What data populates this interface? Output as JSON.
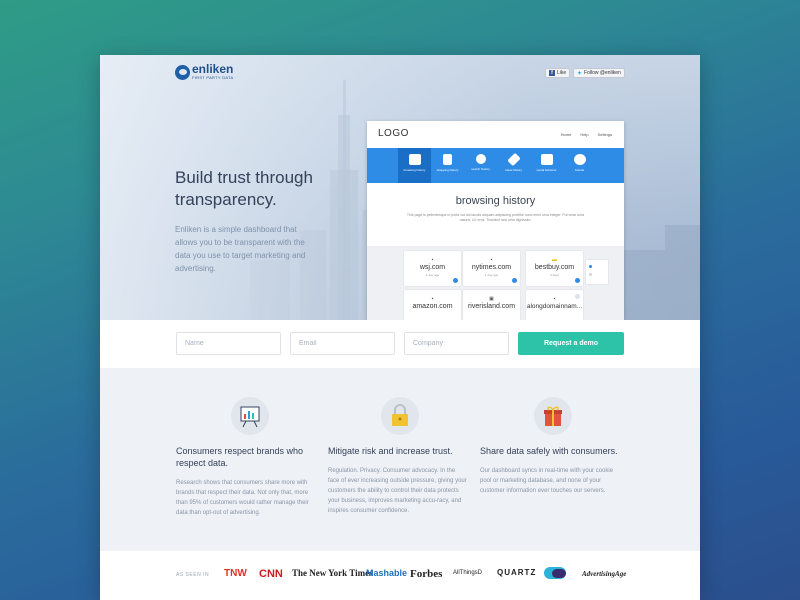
{
  "brand": {
    "name": "enliken",
    "tagline": "FIRST PARTY DATA"
  },
  "social": {
    "like_label": "Like",
    "follow_label": "Follow @enliken"
  },
  "hero": {
    "headline": "Build trust through transparency.",
    "subtext": "Enliken is a simple dashboard that allows you to be transparent with the data you use to target marketing and advertising."
  },
  "mockup": {
    "logo": "LOGO",
    "nav": [
      "Home",
      "Help",
      "Settings"
    ],
    "tabs": [
      "browsing history",
      "shopping history",
      "search history",
      "travel history",
      "social behavior",
      "brands"
    ],
    "icons": [
      "window-icon",
      "shopping-bag-icon",
      "magnifier-icon",
      "airplane-icon",
      "chat-icon",
      "brand-icon"
    ],
    "title": "browsing history",
    "description": "This page is pellentesque in porta vut dui iaculis aliquam adipiscing porttitor nunc enim urna integer. Put vinar urna mauris. Ut, eros. Tincidunt sed urna dignissim.",
    "sites": [
      {
        "name": "wsj.com",
        "time": "1 day ago"
      },
      {
        "name": "nytimes.com",
        "time": "1 day ago"
      },
      {
        "name": "bestbuy.com",
        "time": "3 days"
      },
      {
        "name": "amazon.com",
        "time": ""
      },
      {
        "name": "riverisland.com",
        "time": ""
      },
      {
        "name": "alongdomainnam...",
        "time": ""
      }
    ]
  },
  "form": {
    "name_placeholder": "Name",
    "email_placeholder": "Email",
    "company_placeholder": "Company",
    "cta_label": "Request a demo"
  },
  "features": [
    {
      "icon": "presentation-chart-icon",
      "title": "Consumers respect brands who respect data.",
      "body": "Research shows that consumers share more with brands that respect their data. Not only that, more than 95% of customers would rather manage their data than opt-out of advertising."
    },
    {
      "icon": "padlock-icon",
      "title": "Mitigate risk and increase trust.",
      "body": "Regulation. Privacy. Consumer advocacy. In the face of ever increasing outside pressure, giving your customers the ability to control their data protects your business, improves marketing accu-racy, and inspires consumer confidence."
    },
    {
      "icon": "gift-box-icon",
      "title": "Share data safely with consumers.",
      "body": "Our dashboard syncs in real-time with your cookie pool or marketing database, and none of your customer information ever touches our servers."
    }
  ],
  "press": {
    "label": "AS SEEN IN",
    "logos": [
      "TNW",
      "CNN",
      "The New York Times",
      "Mashable",
      "Forbes",
      "AllThingsD",
      "QUARTZ",
      "",
      "AdvertisingAge"
    ]
  },
  "colors": {
    "accent": "#2cc3a9",
    "blue": "#2e8ce6",
    "heading": "#34425a"
  }
}
